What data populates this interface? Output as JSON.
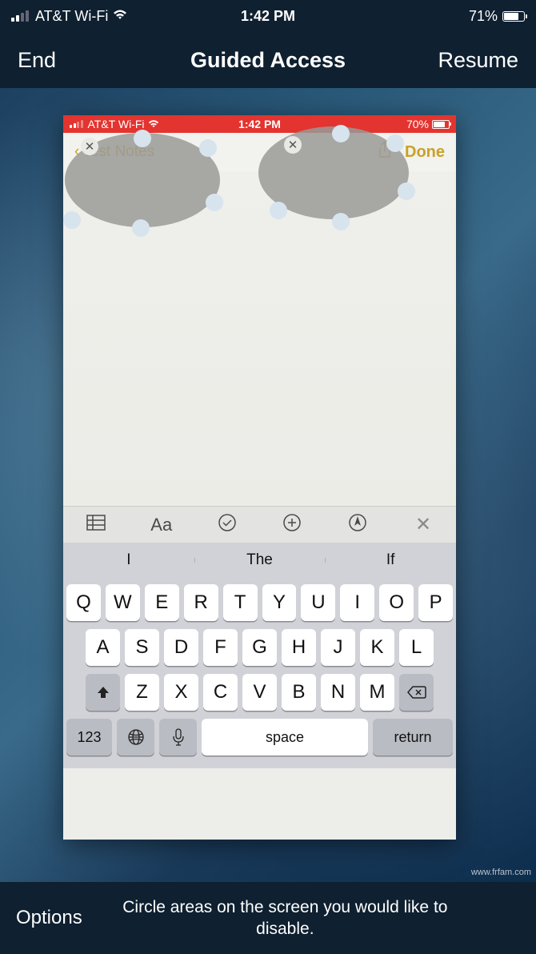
{
  "outer": {
    "carrier": "AT&T Wi-Fi",
    "time": "1:42 PM",
    "battery": "71%",
    "nav_end": "End",
    "nav_title": "Guided Access",
    "nav_resume": "Resume"
  },
  "inner": {
    "carrier": "AT&T Wi-Fi",
    "time": "1:42 PM",
    "battery": "70%",
    "back_label": "Test Notes",
    "done_label": "Done"
  },
  "toolbar": {
    "table_icon": "table-icon",
    "format_label": "Aa",
    "check_icon": "check-circle-icon",
    "add_icon": "plus-circle-icon",
    "draw_icon": "draw-icon",
    "close_icon": "close-icon"
  },
  "suggestions": [
    "I",
    "The",
    "If"
  ],
  "keyboard": {
    "row1": [
      "Q",
      "W",
      "E",
      "R",
      "T",
      "Y",
      "U",
      "I",
      "O",
      "P"
    ],
    "row2": [
      "A",
      "S",
      "D",
      "F",
      "G",
      "H",
      "J",
      "K",
      "L"
    ],
    "row3": [
      "Z",
      "X",
      "C",
      "V",
      "B",
      "N",
      "M"
    ],
    "num_label": "123",
    "space_label": "space",
    "return_label": "return"
  },
  "bottom": {
    "options_label": "Options",
    "hint": "Circle areas on the screen you would like to disable."
  },
  "watermark": "www.frfam.com"
}
